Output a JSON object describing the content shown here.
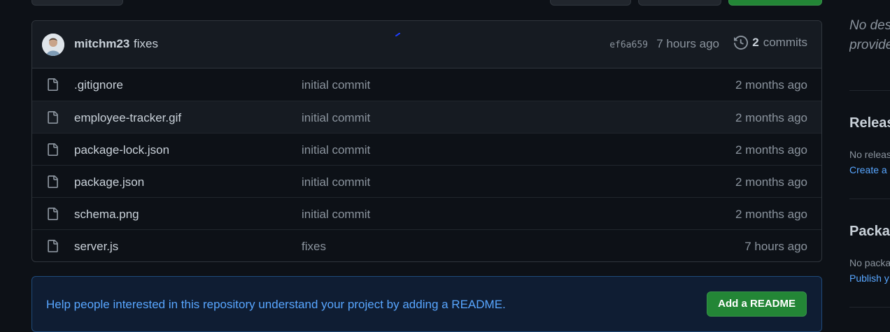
{
  "commit": {
    "author": "mitchm23",
    "message": "fixes",
    "sha": "ef6a659",
    "time": "7 hours ago",
    "commit_count": "2",
    "commits_label": "commits"
  },
  "files": [
    {
      "name": ".gitignore",
      "message": "initial commit",
      "age": "2 months ago"
    },
    {
      "name": "employee-tracker.gif",
      "message": "initial commit",
      "age": "2 months ago"
    },
    {
      "name": "package-lock.json",
      "message": "initial commit",
      "age": "2 months ago"
    },
    {
      "name": "package.json",
      "message": "initial commit",
      "age": "2 months ago"
    },
    {
      "name": "schema.png",
      "message": "initial commit",
      "age": "2 months ago"
    },
    {
      "name": "server.js",
      "message": "fixes",
      "age": "7 hours ago"
    }
  ],
  "readme_banner": {
    "text": "Help people interested in this repository understand your project by adding a README.",
    "button_label": "Add a README"
  },
  "sidebar": {
    "description_line1": "No des",
    "description_line2": "provide",
    "releases_title": "Releas",
    "releases_text": "No releas",
    "releases_link": "Create a",
    "packages_title": "Packag",
    "packages_text": "No packa",
    "packages_link": "Publish y"
  },
  "colors": {
    "background": "#0d1117",
    "accent_green": "#238636",
    "link_blue": "#58a6ff",
    "muted_text": "#8b949e"
  },
  "icons": {
    "file": "file-icon",
    "history": "history-icon"
  }
}
